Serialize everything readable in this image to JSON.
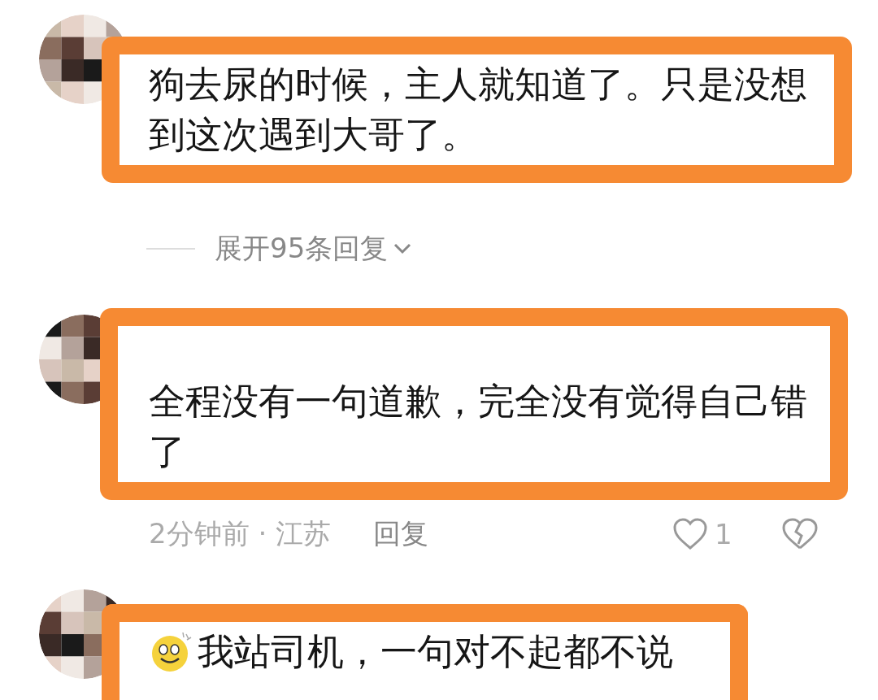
{
  "comments": [
    {
      "text": "狗去尿的时候，主人就知道了。只是没想到这次遇到大哥了。",
      "highlighted": true,
      "has_emoji": false,
      "replies_toggle": "展开95条回复"
    },
    {
      "text": "全程没有一句道歉，完全没有觉得自己错了",
      "highlighted": true,
      "has_emoji": false,
      "meta": {
        "time": "2分钟前 · 江苏",
        "reply": "回复",
        "likes": "1",
        "liked": false
      }
    },
    {
      "text": "我站司机，一句对不起都不说",
      "highlighted": true,
      "has_emoji": true
    }
  ]
}
